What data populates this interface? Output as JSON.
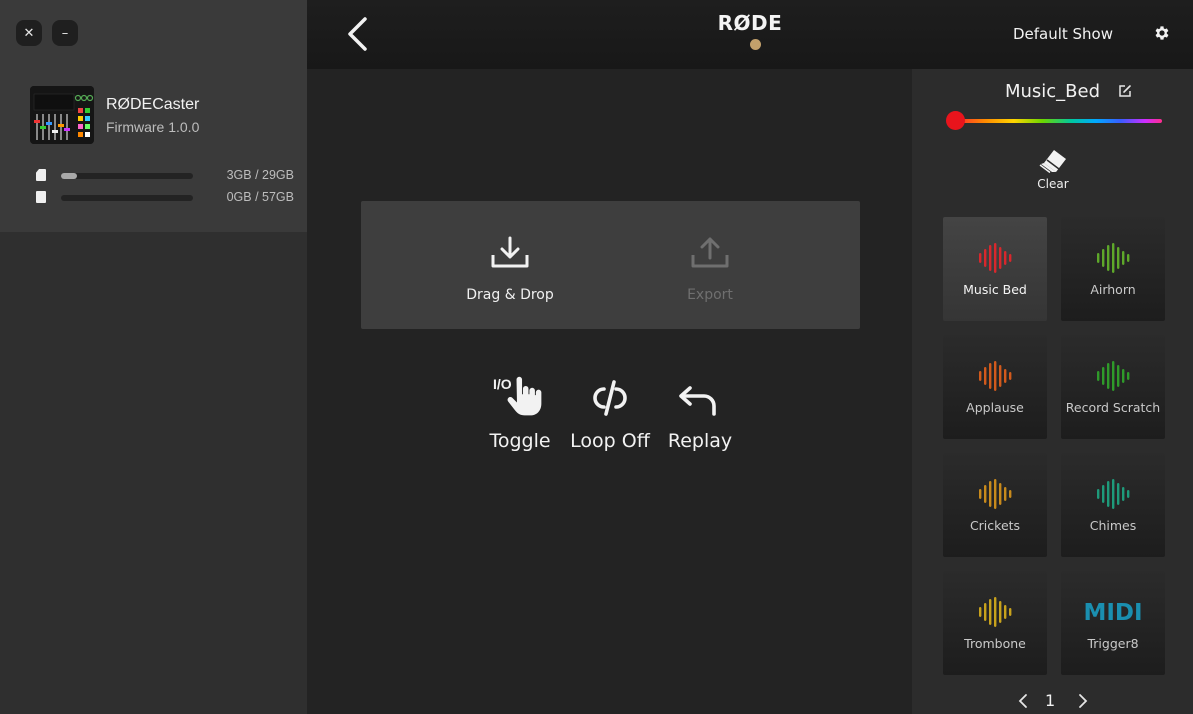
{
  "window": {
    "close_glyph": "✕",
    "minimize_glyph": "–"
  },
  "device": {
    "name": "RØDECaster",
    "firmware": "Firmware 1.0.0",
    "storage": [
      {
        "icon": "sd-card-icon",
        "capacity": "3GB / 29GB",
        "used_fraction": 0.12
      },
      {
        "icon": "drive-icon",
        "capacity": "0GB / 57GB",
        "used_fraction": 0.0
      }
    ]
  },
  "header": {
    "logo": "RØDE",
    "show_name": "Default Show",
    "accent_color": "#c2a06b"
  },
  "dropzone": {
    "drag_label": "Drag & Drop",
    "export_label": "Export"
  },
  "controls": {
    "toggle_label": "Toggle",
    "toggle_badge": "I/O",
    "loop_label": "Loop Off",
    "replay_label": "Replay"
  },
  "pad_editor": {
    "title": "Music_Bed",
    "selected_color": "#e8141c",
    "clear_label": "Clear"
  },
  "pads": [
    {
      "label": "Music Bed",
      "color": "#d9272c",
      "active": true,
      "icon": "waveform-icon"
    },
    {
      "label": "Airhorn",
      "color": "#5ea82a",
      "active": false,
      "icon": "waveform-icon"
    },
    {
      "label": "Applause",
      "color": "#d25a1c",
      "active": false,
      "icon": "waveform-icon"
    },
    {
      "label": "Record Scratch",
      "color": "#2f9a2a",
      "active": false,
      "icon": "waveform-icon"
    },
    {
      "label": "Crickets",
      "color": "#c88a1c",
      "active": false,
      "icon": "waveform-icon"
    },
    {
      "label": "Chimes",
      "color": "#1e9a7a",
      "active": false,
      "icon": "waveform-icon"
    },
    {
      "label": "Trombone",
      "color": "#c8a21c",
      "active": false,
      "icon": "waveform-icon"
    },
    {
      "label": "Trigger8",
      "color": "#1a8fb0",
      "active": false,
      "icon": "midi-icon",
      "icon_text": "MIDI"
    }
  ],
  "pager": {
    "page": "1"
  }
}
